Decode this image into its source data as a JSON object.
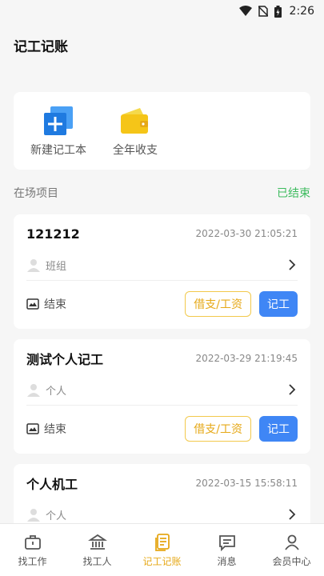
{
  "status_bar": {
    "time": "2:26"
  },
  "header": {
    "title": "记工记账"
  },
  "quick_actions": [
    {
      "label": "新建记工本",
      "icon": "add-book-icon"
    },
    {
      "label": "全年收支",
      "icon": "wallet-icon"
    }
  ],
  "section": {
    "label": "在场项目",
    "link": "已结束"
  },
  "projects": [
    {
      "name": "121212",
      "time": "2022-03-30 21:05:21",
      "group": "班组",
      "end_label": "结束",
      "borrow_label": "借支/工资",
      "record_label": "记工"
    },
    {
      "name": "测试个人记工",
      "time": "2022-03-29 21:19:45",
      "group": "个人",
      "end_label": "结束",
      "borrow_label": "借支/工资",
      "record_label": "记工"
    },
    {
      "name": "个人机工",
      "time": "2022-03-15 15:58:11",
      "group": "个人"
    }
  ],
  "nav": [
    {
      "label": "找工作",
      "icon": "briefcase-icon"
    },
    {
      "label": "找工人",
      "icon": "bank-icon"
    },
    {
      "label": "记工记账",
      "icon": "ledger-icon",
      "active": true
    },
    {
      "label": "消息",
      "icon": "message-icon"
    },
    {
      "label": "会员中心",
      "icon": "user-icon"
    }
  ],
  "colors": {
    "accent_blue": "#3f86f5",
    "accent_yellow": "#f2c94c",
    "active_green": "#3dbb5e"
  }
}
